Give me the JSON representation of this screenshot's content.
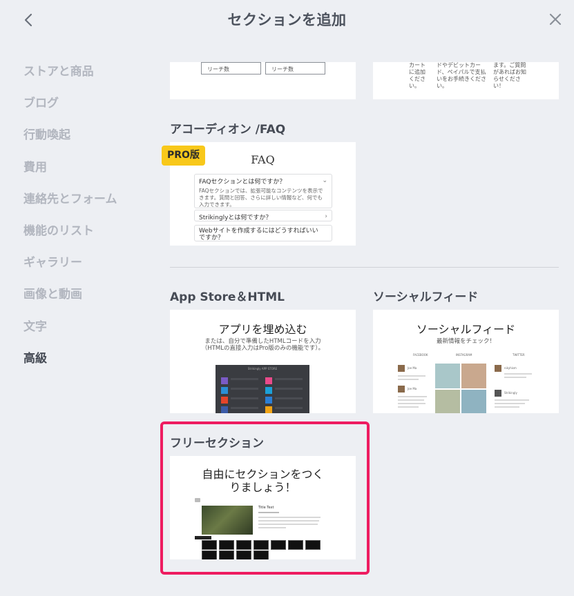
{
  "header": {
    "title": "セクションを追加"
  },
  "sidebar": {
    "items": [
      {
        "label": "ストアと商品"
      },
      {
        "label": "ブログ"
      },
      {
        "label": "行動喚起"
      },
      {
        "label": "費用"
      },
      {
        "label": "連絡先とフォーム"
      },
      {
        "label": "機能のリスト"
      },
      {
        "label": "ギャラリー"
      },
      {
        "label": "画像と動画"
      },
      {
        "label": "文字"
      },
      {
        "label": "高級"
      }
    ],
    "active_index": 9
  },
  "partial_cards": {
    "reach_label_1": "リーチ数",
    "reach_label_2": "リーチ数",
    "text_col_1": "カート\nに追加\nくださ\nい。",
    "text_col_2": "ドやデビットカー\nド、ペイパルで支払\nいをお手続きくださ\nい。",
    "text_col_3": "ます。ご質問\nがあればお知\nらせくださ\nい！"
  },
  "faq_section": {
    "label": "アコーディオン /FAQ",
    "badge": "PRO版",
    "title": "FAQ",
    "q1": "FAQセクションとは何ですか？",
    "a1": "FAQセクションでは、拡張可能なコンテンツを表示できます。質問と回答、さらに詳しい情報など、何でも入力できます。",
    "q2": "Strikinglyとは何ですか？",
    "q3": "Webサイトを作成するにはどうすればいいですか？"
  },
  "appstore_section": {
    "label": "App Store＆HTML",
    "heading": "アプリを埋め込む",
    "subtext": "または、自分で準備したHTMLコードを入力（HTMLの直接入力はPro版のみの機能です）。",
    "panel_title": "Strikingly APP STORE"
  },
  "social_section": {
    "label": "ソーシャルフィード",
    "heading": "ソーシャルフィード",
    "subtext": "最新情報をチェック！",
    "columns": [
      "FACEBOOK",
      "INSTAGRAM",
      "TWITTER"
    ],
    "users": [
      "Joe Ma",
      "Joe Ma",
      "Strikingly",
      "nikyhism"
    ]
  },
  "free_section": {
    "label": "フリーセクション",
    "heading": "自由にセクションをつく\nりましょう！",
    "preview_title": "Title Text",
    "tool_labels": [
      "Heading",
      "Text",
      "Image",
      "Video",
      "Button",
      "Sign Up",
      "Contact Form"
    ]
  },
  "colors": {
    "background": "#edeff3",
    "highlight": "#ee1c60",
    "pro_badge": "#f8c81a",
    "sidebar_active": "#464b55",
    "sidebar_inactive": "#b2b6bf"
  }
}
